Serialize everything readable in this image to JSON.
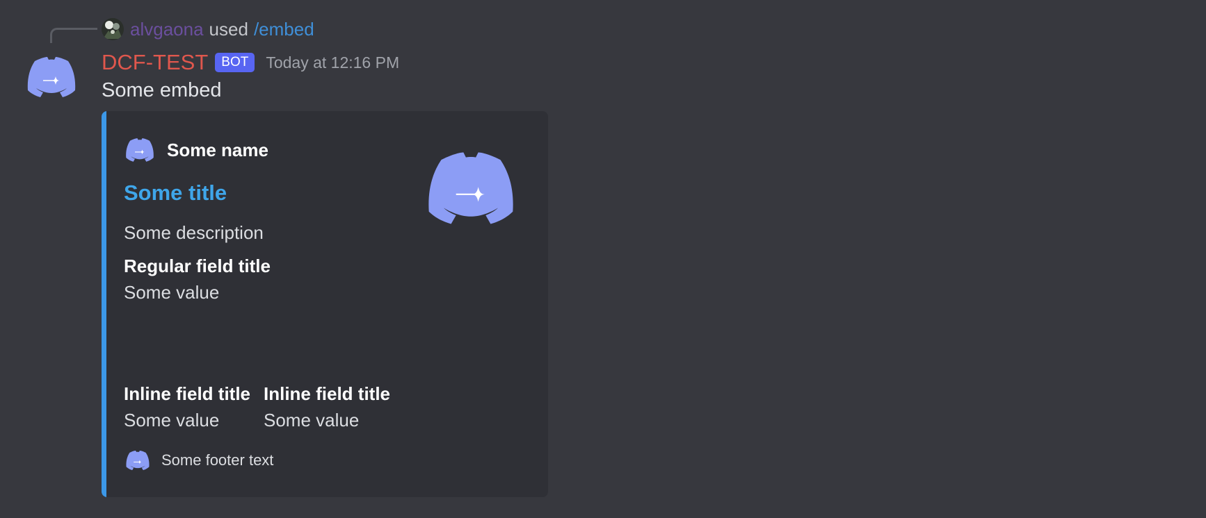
{
  "reply": {
    "username": "alvgaona",
    "used_text": "used",
    "command": "/embed"
  },
  "message": {
    "author": "DCF-TEST",
    "bot_badge": "BOT",
    "timestamp": "Today at 12:16 PM",
    "content": "Some embed"
  },
  "embed": {
    "accent_color": "#3c98e8",
    "author_name": "Some name",
    "title": "Some title",
    "description": "Some description",
    "fields": [
      {
        "name": "Regular field title",
        "value": "Some value",
        "inline": false
      },
      {
        "name": "Inline field title",
        "value": "Some value",
        "inline": true
      },
      {
        "name": "Inline field title",
        "value": "Some value",
        "inline": true
      }
    ],
    "footer_text": "Some footer text"
  },
  "icons": {
    "avatar": "discord-logo-icon",
    "reply_avatar": "user-avatar",
    "thumbnail": "discord-logo-icon"
  },
  "colors": {
    "background": "#37383e",
    "embed_background": "#2f3036",
    "author": "#e0574d",
    "bot_badge": "#5865f2",
    "title_link": "#3fa6ea",
    "blurple": "#8c9df5"
  }
}
